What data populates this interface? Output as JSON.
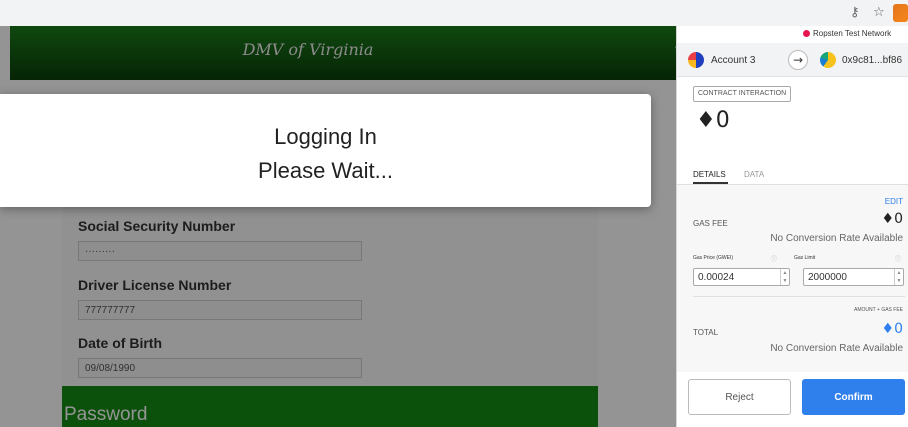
{
  "browser": {
    "icons": {
      "key": "key-icon",
      "star": "star-icon",
      "extension": "metamask-fox-icon"
    }
  },
  "page": {
    "header_title": "DMV of Virginia",
    "header_fragment": "Vi",
    "modal": {
      "line1": "Logging In",
      "line2": "Please Wait..."
    },
    "form": {
      "fields": [
        {
          "label": "Social Security Number",
          "value": "·········"
        },
        {
          "label": "Driver License Number",
          "value": "777777777"
        },
        {
          "label": "Date of Birth",
          "value": "09/08/1990"
        }
      ],
      "password_label": "Password"
    },
    "colors": {
      "header_green": "#1b7d1b",
      "password_green": "#138a13"
    }
  },
  "metamask": {
    "network": "Ropsten Test Network",
    "network_color": "#e91550",
    "from_account": "Account 3",
    "to_address": "0x9c81...bf86",
    "tx_type": "CONTRACT INTERACTION",
    "total_amount": "0",
    "eth_symbol": "♦",
    "tabs": {
      "details": "DETAILS",
      "data": "DATA"
    },
    "edit_label": "EDIT",
    "gas_fee_label": "GAS FEE",
    "gas_fee_value": "0",
    "no_conversion": "No Conversion Rate Available",
    "gas_price_label": "Gas Price (GWEI)",
    "gas_limit_label": "Gas Limit",
    "gas_price_value": "0.00024",
    "gas_limit_value": "2000000",
    "amount_gas_label": "AMOUNT + GAS FEE",
    "total_label": "TOTAL",
    "total_value": "0",
    "reject_label": "Reject",
    "confirm_label": "Confirm",
    "accent_color": "#2f80ed"
  }
}
